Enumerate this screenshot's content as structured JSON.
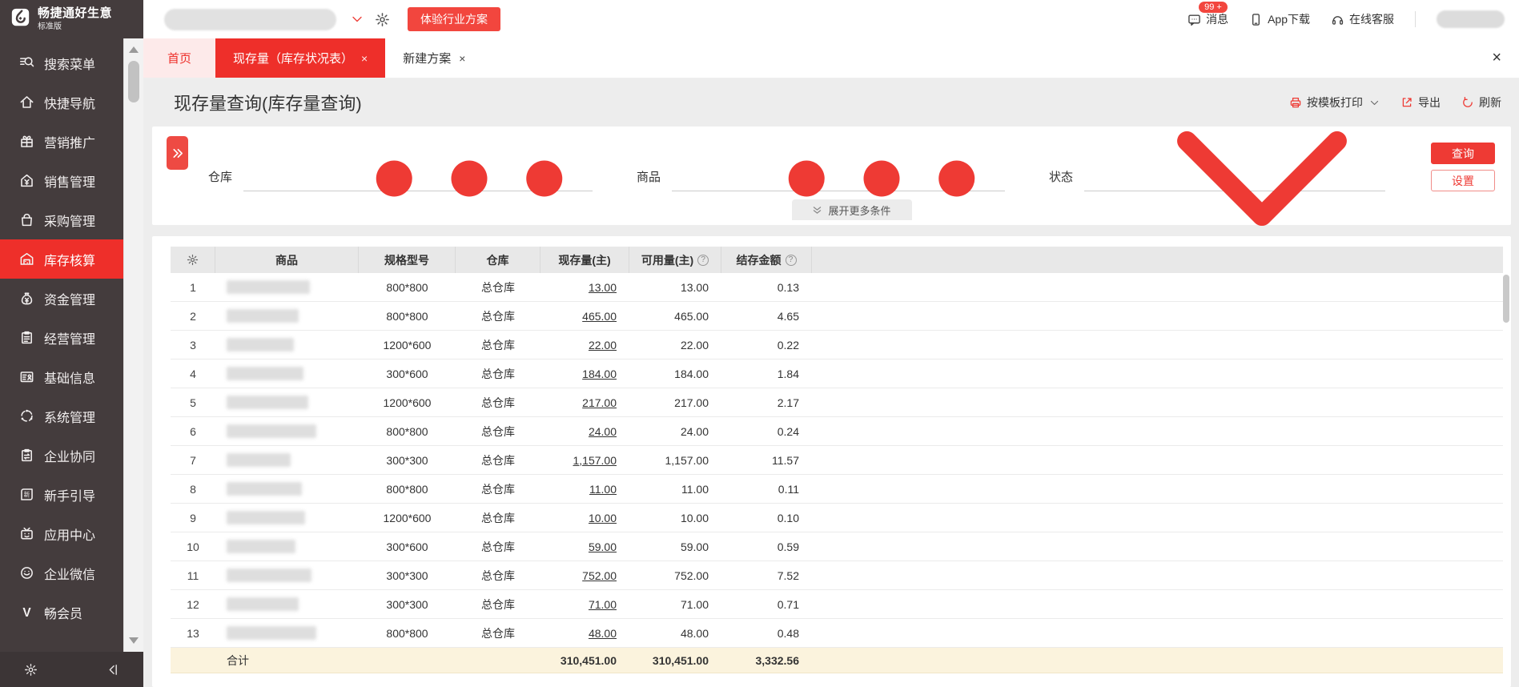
{
  "brand": {
    "name": "畅捷通好生意",
    "edition": "标准版",
    "accent": "#ee3a34"
  },
  "topbar": {
    "company_selector": {
      "redacted": true
    },
    "trial_button": "体验行业方案",
    "messages_label": "消息",
    "messages_badge": "99 +",
    "app_download_label": "App下载",
    "online_service_label": "在线客服",
    "user": {
      "redacted": true
    }
  },
  "tabs": [
    {
      "label": "首页",
      "closable": false,
      "active": false,
      "style": "home"
    },
    {
      "label": "现存量（库存状况表）",
      "closable": true,
      "active": true
    },
    {
      "label": "新建方案",
      "closable": true,
      "active": false
    }
  ],
  "page": {
    "title": "现存量查询(库存量查询)",
    "actions": {
      "print": "按模板打印",
      "export": "导出",
      "refresh": "刷新"
    }
  },
  "filters": {
    "fields": [
      {
        "label": "仓库",
        "value": "",
        "suffix": "ellipsis"
      },
      {
        "label": "商品",
        "value": "",
        "suffix": "ellipsis"
      },
      {
        "label": "状态",
        "value": "",
        "suffix": "chevron-down"
      }
    ],
    "query_button": "查询",
    "settings_button": "设置",
    "expand_more": "展开更多条件"
  },
  "sidebar": {
    "active_index": 5,
    "items": [
      {
        "id": "search-menu",
        "icon": "search-menu",
        "label": "搜索菜单"
      },
      {
        "id": "quick-nav",
        "icon": "quick-nav",
        "label": "快捷导航"
      },
      {
        "id": "marketing",
        "icon": "marketing",
        "label": "营销推广"
      },
      {
        "id": "sales",
        "icon": "sales",
        "label": "销售管理"
      },
      {
        "id": "purchase",
        "icon": "purchase",
        "label": "采购管理"
      },
      {
        "id": "inventory",
        "icon": "inventory",
        "label": "库存核算"
      },
      {
        "id": "funds",
        "icon": "funds",
        "label": "资金管理"
      },
      {
        "id": "operations",
        "icon": "operations",
        "label": "经营管理"
      },
      {
        "id": "basic-info",
        "icon": "basic-info",
        "label": "基础信息"
      },
      {
        "id": "system",
        "icon": "system",
        "label": "系统管理"
      },
      {
        "id": "collab",
        "icon": "collab",
        "label": "企业协同"
      },
      {
        "id": "newbie",
        "icon": "newbie",
        "label": "新手引导"
      },
      {
        "id": "app-center",
        "icon": "app-center",
        "label": "应用中心"
      },
      {
        "id": "wecom",
        "icon": "wecom",
        "label": "企业微信"
      },
      {
        "id": "member",
        "icon": "member",
        "label": "畅会员"
      }
    ]
  },
  "table": {
    "columns": [
      "商品",
      "规格型号",
      "仓库",
      "现存量(主)",
      "可用量(主)",
      "结存金额"
    ],
    "help_columns": [
      "可用量(主)",
      "结存金额"
    ],
    "rows": [
      {
        "num": "1",
        "product_redacted": true,
        "spec": "800*800",
        "warehouse": "总仓库",
        "qty": "13.00",
        "available": "13.00",
        "amount": "0.13"
      },
      {
        "num": "2",
        "product_redacted": true,
        "spec": "800*800",
        "warehouse": "总仓库",
        "qty": "465.00",
        "available": "465.00",
        "amount": "4.65"
      },
      {
        "num": "3",
        "product_redacted": true,
        "spec": "1200*600",
        "warehouse": "总仓库",
        "qty": "22.00",
        "available": "22.00",
        "amount": "0.22"
      },
      {
        "num": "4",
        "product_redacted": true,
        "spec": "300*600",
        "warehouse": "总仓库",
        "qty": "184.00",
        "available": "184.00",
        "amount": "1.84"
      },
      {
        "num": "5",
        "product_redacted": true,
        "spec": "1200*600",
        "warehouse": "总仓库",
        "qty": "217.00",
        "available": "217.00",
        "amount": "2.17"
      },
      {
        "num": "6",
        "product_redacted": true,
        "spec": "800*800",
        "warehouse": "总仓库",
        "qty": "24.00",
        "available": "24.00",
        "amount": "0.24"
      },
      {
        "num": "7",
        "product_redacted": true,
        "spec": "300*300",
        "warehouse": "总仓库",
        "qty": "1,157.00",
        "available": "1,157.00",
        "amount": "11.57"
      },
      {
        "num": "8",
        "product_redacted": true,
        "spec": "800*800",
        "warehouse": "总仓库",
        "qty": "11.00",
        "available": "11.00",
        "amount": "0.11"
      },
      {
        "num": "9",
        "product_redacted": true,
        "spec": "1200*600",
        "warehouse": "总仓库",
        "qty": "10.00",
        "available": "10.00",
        "amount": "0.10"
      },
      {
        "num": "10",
        "product_redacted": true,
        "spec": "300*600",
        "warehouse": "总仓库",
        "qty": "59.00",
        "available": "59.00",
        "amount": "0.59"
      },
      {
        "num": "11",
        "product_redacted": true,
        "spec": "300*300",
        "warehouse": "总仓库",
        "qty": "752.00",
        "available": "752.00",
        "amount": "7.52"
      },
      {
        "num": "12",
        "product_redacted": true,
        "spec": "300*300",
        "warehouse": "总仓库",
        "qty": "71.00",
        "available": "71.00",
        "amount": "0.71"
      },
      {
        "num": "13",
        "product_redacted": true,
        "spec": "800*800",
        "warehouse": "总仓库",
        "qty": "48.00",
        "available": "48.00",
        "amount": "0.48"
      }
    ],
    "total": {
      "label": "合计",
      "qty": "310,451.00",
      "available": "310,451.00",
      "amount": "3,332.56"
    }
  }
}
